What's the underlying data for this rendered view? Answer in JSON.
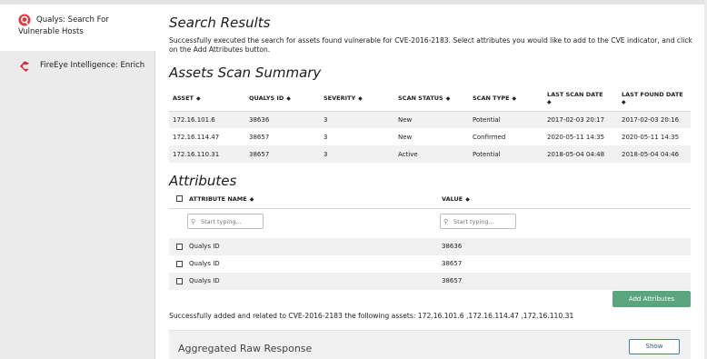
{
  "sidebar": {
    "items": [
      {
        "label": "Qualys: Search For Vulnerable Hosts",
        "icon": "qualys-icon"
      },
      {
        "label": "FireEye Intelligence: Enrich",
        "icon": "fireeye-icon"
      }
    ]
  },
  "main": {
    "title": "Search Results",
    "description": "Successfully executed the search for assets found vulnerable for CVE-2016-2183. Select attributes you would like to add to the CVE indicator, and click on the Add Attributes button.",
    "assets_heading": "Assets Scan Summary",
    "assets_table": {
      "columns": [
        "ASSET",
        "QUALYS ID",
        "SEVERITY",
        "SCAN STATUS",
        "SCAN TYPE",
        "LAST SCAN DATE",
        "LAST FOUND DATE"
      ],
      "rows": [
        [
          "172.16.101.6",
          "38636",
          "3",
          "New",
          "Potential",
          "2017-02-03 20:17",
          "2017-02-03 20:16"
        ],
        [
          "172.16.114.47",
          "38657",
          "3",
          "New",
          "Confirmed",
          "2020-05-11 14:35",
          "2020-05-11 14:35"
        ],
        [
          "172.16.110.31",
          "38657",
          "3",
          "Active",
          "Potential",
          "2018-05-04 04:48",
          "2018-05-04 04:46"
        ]
      ]
    },
    "attributes_heading": "Attributes",
    "attributes_table": {
      "columns": [
        "ATTRIBUTE NAME",
        "VALUE"
      ],
      "filter_placeholder": "Start typing...",
      "rows": [
        {
          "name": "Qualys ID",
          "value": "38636"
        },
        {
          "name": "Qualys ID",
          "value": "38657"
        },
        {
          "name": "Qualys ID",
          "value": "38657"
        }
      ]
    },
    "add_button": "Add Attributes",
    "success_message": "Successfully added and related to CVE-2016-2183 the following assets: 172.16.101.6 ,172.16.114.47 ,172.16.110.31",
    "aggregated_title": "Aggregated Raw Response",
    "show_button": "Show"
  },
  "colors": {
    "accent_green": "#5aa47e",
    "qualys_red": "#e03a3e",
    "fireeye_red": "#d3262f",
    "link_blue": "#2c5a8a"
  }
}
